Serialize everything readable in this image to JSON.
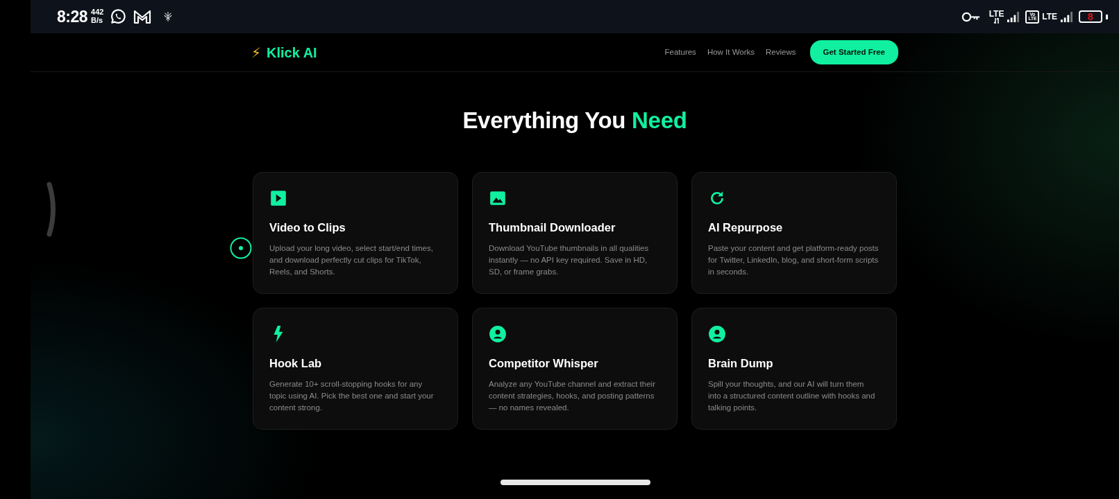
{
  "status_bar": {
    "time": "8:28",
    "speed_value": "442",
    "speed_unit": "B/s",
    "network_1": "LTE",
    "volte_top": "Vo",
    "volte_bottom": "LTE",
    "network_2": "LTE",
    "battery": "8"
  },
  "nav": {
    "logo_icon": "⚡",
    "logo_text": "Klick AI",
    "links": [
      "Features",
      "How It Works",
      "Reviews"
    ],
    "cta": "Get Started Free"
  },
  "section": {
    "title_start": "Everything You",
    "title_accent": "Need"
  },
  "features": [
    {
      "kind": "play",
      "title": "Video to Clips",
      "description": "Upload your long video, select start/end times, and download perfectly cut clips for TikTok, Reels, and Shorts."
    },
    {
      "kind": "image",
      "title": "Thumbnail Downloader",
      "description": "Download YouTube thumbnails in all qualities instantly — no API key required. Save in HD, SD, or frame grabs."
    },
    {
      "kind": "refresh",
      "title": "AI Repurpose",
      "description": "Paste your content and get platform-ready posts for Twitter, LinkedIn, blog, and short-form scripts in seconds."
    },
    {
      "kind": "bolt",
      "title": "Hook Lab",
      "description": "Generate 10+ scroll-stopping hooks for any topic using AI. Pick the best one and start your content strong."
    },
    {
      "kind": "person",
      "title": "Competitor Whisper",
      "description": "Analyze any YouTube channel and extract their content strategies, hooks, and posting patterns — no names revealed."
    },
    {
      "kind": "person",
      "title": "Brain Dump",
      "description": "Spill your thoughts, and our AI will turn them into a structured content outline with hooks and talking points."
    }
  ]
}
